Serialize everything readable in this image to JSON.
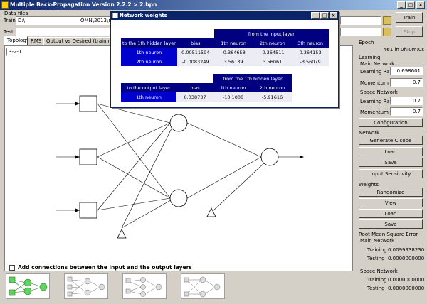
{
  "window": {
    "title": "Multiple Back-Propagation Version 2.2.2 > 2.bpn"
  },
  "data_files": {
    "caption": "Data files",
    "train_label": "Train",
    "train_path": "D:\\",
    "train_path_tail": "OMN\\2013\\nb",
    "test_label": "Test",
    "test_path": ""
  },
  "buttons": {
    "train": "Train",
    "stop": "Stop"
  },
  "tabs": [
    "Topology",
    "RMS",
    "Output vs Desired (training data"
  ],
  "topology": {
    "value": "3-2-1",
    "add_connections_label": "Add connections between the input and the output layers"
  },
  "popup": {
    "title": "Network weights",
    "input_group_header": "from the input layer",
    "hidden_table_header": "to the 1th hidden layer",
    "col_bias": "bias",
    "input_cols": [
      "1th neuron",
      "2th neuron",
      "3th neuron"
    ],
    "hidden_rows": [
      {
        "label": "1th neuron",
        "bias": "0.00511594",
        "w": [
          "-0.364658",
          "-0.364511",
          "0.364153"
        ]
      },
      {
        "label": "2th neuron",
        "bias": "-0.0083249",
        "w": [
          "3.56139",
          "3.56061",
          "-3.56079"
        ]
      }
    ],
    "hidden_group_header": "from the 1th hidden layer",
    "output_table_header": "to the output layer",
    "hidden_cols": [
      "1th neuron",
      "2th neuron"
    ],
    "output_rows": [
      {
        "label": "1th neuron",
        "bias": "0.038737",
        "w": [
          "-10.1008",
          "-5.91616"
        ]
      }
    ]
  },
  "epoch": {
    "label": "Epoch",
    "value": "461 in 0h:0m:0s"
  },
  "learning": {
    "caption": "Learning",
    "main_caption": "Main Network",
    "main_rate_label": "Learning Rate",
    "main_rate": "0.698601",
    "main_momentum_label": "Momentum",
    "main_momentum": "0.7",
    "space_caption": "Space Network",
    "space_rate_label": "Learning Rate",
    "space_rate": "0.7",
    "space_momentum_label": "Momentum",
    "space_momentum": "0.7",
    "configuration": "Configuration"
  },
  "network": {
    "caption": "Network",
    "generate_c": "Generate C code",
    "load": "Load",
    "save": "Save",
    "input_sensitivity": "Input Sensitivity"
  },
  "weights": {
    "caption": "Weights",
    "randomize": "Randomize",
    "view": "View",
    "load": "Load",
    "save": "Save"
  },
  "rmse": {
    "caption": "Root Mean Square Error",
    "main_caption": "Main Network",
    "training_label": "Training",
    "training": "0.0099938230",
    "testing_label": "Testing",
    "testing": "0.0000000000",
    "space_caption": "Space Network",
    "space_training_label": "Training",
    "space_training": "0.0000000000",
    "space_testing_label": "Testing",
    "space_testing": "0.0000000000"
  }
}
